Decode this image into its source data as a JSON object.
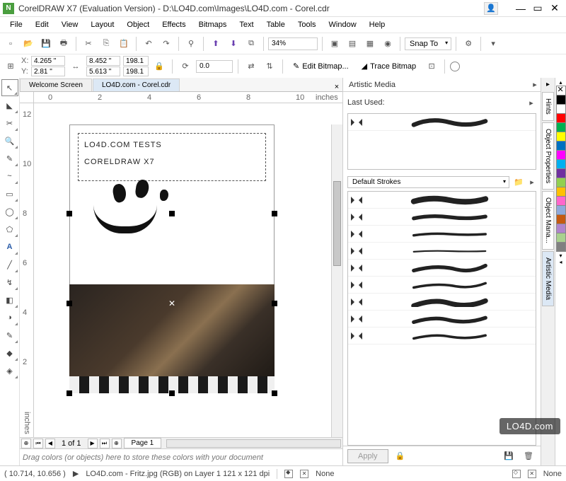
{
  "window": {
    "title": "CorelDRAW X7 (Evaluation Version) - D:\\LO4D.com\\Images\\LO4D.com - Corel.cdr",
    "app_icon_letter": "N"
  },
  "menu": [
    "File",
    "Edit",
    "View",
    "Layout",
    "Object",
    "Effects",
    "Bitmaps",
    "Text",
    "Table",
    "Tools",
    "Window",
    "Help"
  ],
  "toolbar": {
    "zoom_value": "34%",
    "snap": "Snap To"
  },
  "propbar": {
    "x": "4.265 \"",
    "y": "2.81 \"",
    "w": "8.452 \"",
    "h": "5.613 \"",
    "sx": "198.1",
    "sy": "198.1",
    "rot": "0.0",
    "edit_bitmap": "Edit Bitmap...",
    "trace_bitmap": "Trace Bitmap"
  },
  "tabs": {
    "welcome": "Welcome Screen",
    "doc": "LO4D.com - Corel.cdr"
  },
  "rulers": {
    "h": {
      "unit": "inches",
      "ticks": [
        "0",
        "2",
        "4",
        "6",
        "8",
        "10"
      ]
    },
    "v": {
      "unit": "inches",
      "ticks": [
        "12",
        "10",
        "8",
        "6",
        "4",
        "2"
      ]
    }
  },
  "canvas": {
    "text_line1": "LO4D.com tests",
    "text_line2": "CorelDraw X7"
  },
  "pagenav": {
    "info": "1 of 1",
    "page_tab": "Page 1"
  },
  "panel": {
    "title": "Artistic Media",
    "last_used": "Last Used:",
    "category": "Default Strokes",
    "apply": "Apply"
  },
  "dockers": [
    "Hints",
    "Object Properties",
    "Object Mana...",
    "Artistic Media"
  ],
  "colors": [
    "#000000",
    "#ffffff",
    "#ff0000",
    "#00b050",
    "#ffff00",
    "#0070c0",
    "#ff00ff",
    "#00b0f0",
    "#7030a0",
    "#92d050",
    "#ffc000",
    "#ff66cc",
    "#8faadc",
    "#c55a11",
    "#b084cc",
    "#a9d18e",
    "#808080"
  ],
  "colorwell": {
    "hint": "Drag colors (or objects) here to store these colors with your document"
  },
  "statusbar": {
    "coords": "( 10.714, 10.656 )",
    "doc_info": "LO4D.com - Fritz.jpg (RGB) on Layer 1 121 x 121 dpi",
    "fill_none": "None",
    "outline_none": "None"
  },
  "watermark": "LO4D.com"
}
